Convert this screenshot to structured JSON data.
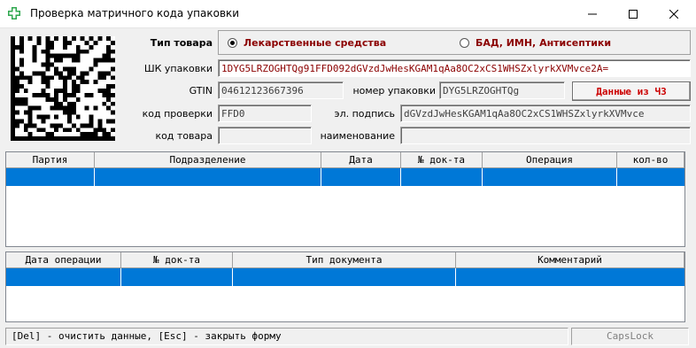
{
  "window": {
    "title": "Проверка матричного кода упаковки"
  },
  "form": {
    "product_type_label": "Тип товара",
    "product_type_options": [
      {
        "label": "Лекарственные средства",
        "selected": true
      },
      {
        "label": "БАД, ИМН, Антисептики",
        "selected": false
      }
    ],
    "barcode_label": "ШК упаковки",
    "barcode_value": "1DYG5LRZOGHTQg91FFD092dGVzdJwHesKGAM1qAa8OC2xCS1WHSZxlyrkXVMvce2A=",
    "gtin_label": "GTIN",
    "gtin_value": "04612123667396",
    "package_number_label": "номер упаковки",
    "package_number_value": "DYG5LRZOGHTQg",
    "cz_button_label": "Данные из ЧЗ",
    "check_code_label": "код проверки",
    "check_code_value": "FFD0",
    "signature_label": "эл. подпись",
    "signature_value": "dGVzdJwHesKGAM1qAa8OC2xCS1WHSZxlyrkXVMvce",
    "product_code_label": "код товара",
    "product_code_value": "",
    "name_label": "наименование",
    "name_value": ""
  },
  "grid1": {
    "columns": [
      "Партия",
      "Подразделение",
      "Дата",
      "№ док-та",
      "Операция",
      "кол-во"
    ]
  },
  "grid2": {
    "columns": [
      "Дата операции",
      "№ док-та",
      "Тип документа",
      "Комментарий"
    ]
  },
  "status": {
    "hint": "[Del] - очистить данные, [Esc] - закрыть форму",
    "capslock": "CapsLock"
  },
  "colors": {
    "accent_red": "#8b0000",
    "button_red": "#cc0000",
    "selection": "#0078d7",
    "app_icon": "#2fa84f"
  }
}
